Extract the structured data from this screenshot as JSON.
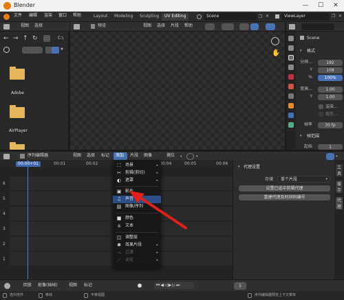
{
  "window": {
    "title": "Blender",
    "controls": [
      "—",
      "☐",
      "✕"
    ]
  },
  "menu": [
    "文件",
    "编辑",
    "渲染",
    "窗口",
    "帮助"
  ],
  "workspace_tabs": [
    {
      "label": "Layout",
      "active": false
    },
    {
      "label": "Modeling",
      "active": false
    },
    {
      "label": "Sculpting",
      "active": false
    },
    {
      "label": "UV Editing",
      "active": true
    }
  ],
  "scene_name": "Scene",
  "view_layer": "ViewLayer",
  "file_browser": {
    "menus": [
      "视图",
      "选择"
    ],
    "path_label": "C:\\",
    "folders": [
      "Adobe",
      "AirPlayer",
      ""
    ]
  },
  "viewport": {
    "mode": "预览",
    "menus": [
      "视图",
      "选择",
      "片段",
      "帮助"
    ]
  },
  "properties": {
    "scene_label": "Scene",
    "format_panel": "格式",
    "resolution_label": "分辨...",
    "res_x": "192",
    "res_y_label": "Y",
    "res_y": "108",
    "percent_label": "%",
    "percent": "100%",
    "aspect_label": "宽高...",
    "aspect_x": "1.00",
    "aspect_y_label": "Y",
    "aspect_y": "1.00",
    "render_region": "渲染...",
    "crop": "裁剪...",
    "fps_label": "帧率",
    "fps": "30 fp",
    "frame_range_panel": "帧范围",
    "start_label": "起始",
    "start": "1"
  },
  "sequencer": {
    "editor_name": "序列编辑器",
    "menus": [
      "视图",
      "选择",
      "标记",
      "添加",
      "片段",
      "图像"
    ],
    "snap": "捕位",
    "time_labels": [
      "00:01",
      "00:02",
      "00:04",
      "00:05",
      "00:06"
    ],
    "current_frame": "00:00+01",
    "channels": [
      "6",
      "5",
      "4",
      "3",
      "2",
      "1"
    ]
  },
  "add_menu": {
    "items": [
      {
        "icon": "⛶",
        "label": "场景",
        "submenu": true,
        "dim": false
      },
      {
        "icon": "✂",
        "label": "剪辑(剪切)",
        "submenu": true,
        "dim": false
      },
      {
        "icon": "◐",
        "label": "遮罩",
        "submenu": true,
        "dim": false
      },
      {
        "sep": true
      },
      {
        "icon": "▣",
        "label": "影片",
        "submenu": false,
        "dim": false
      },
      {
        "icon": "♫",
        "label": "声音",
        "submenu": false,
        "dim": false
      },
      {
        "icon": "▨",
        "label": "图像/序列",
        "submenu": false,
        "dim": false
      },
      {
        "sep": true
      },
      {
        "icon": "■",
        "label": "颜色",
        "submenu": false,
        "dim": false
      },
      {
        "icon": "a",
        "label": "文本",
        "submenu": false,
        "dim": false
      },
      {
        "sep": true
      },
      {
        "icon": "◫",
        "label": "调整层",
        "submenu": false,
        "dim": false
      },
      {
        "icon": "✱",
        "label": "效果片段",
        "submenu": true,
        "dim": false
      },
      {
        "icon": "⤳",
        "label": "过渡",
        "submenu": true,
        "dim": true
      },
      {
        "icon": "⟋",
        "label": "淡化",
        "submenu": true,
        "dim": true
      }
    ]
  },
  "sidebar": {
    "panel_title": "代理设置",
    "storage_label": "存储",
    "storage_value": "单个片段",
    "btn_set": "设置已选中剪辑代理",
    "btn_rebuild": "重建代理及时间码编号",
    "tabs": [
      "工具",
      "缓存",
      "代理"
    ]
  },
  "playback": {
    "menus": [
      "回放",
      "抠像(插帧)",
      "视图",
      "标记"
    ],
    "frame": "1"
  },
  "status": {
    "items": [
      "选中控件",
      "移动",
      "平移视图",
      "序列编辑器预览上下文菜单"
    ]
  },
  "colors": {
    "accent_blue": "#4772b3",
    "highlight": "#2b4e86",
    "arrow_red": "#e0201b",
    "folder": "#e6b65a"
  }
}
